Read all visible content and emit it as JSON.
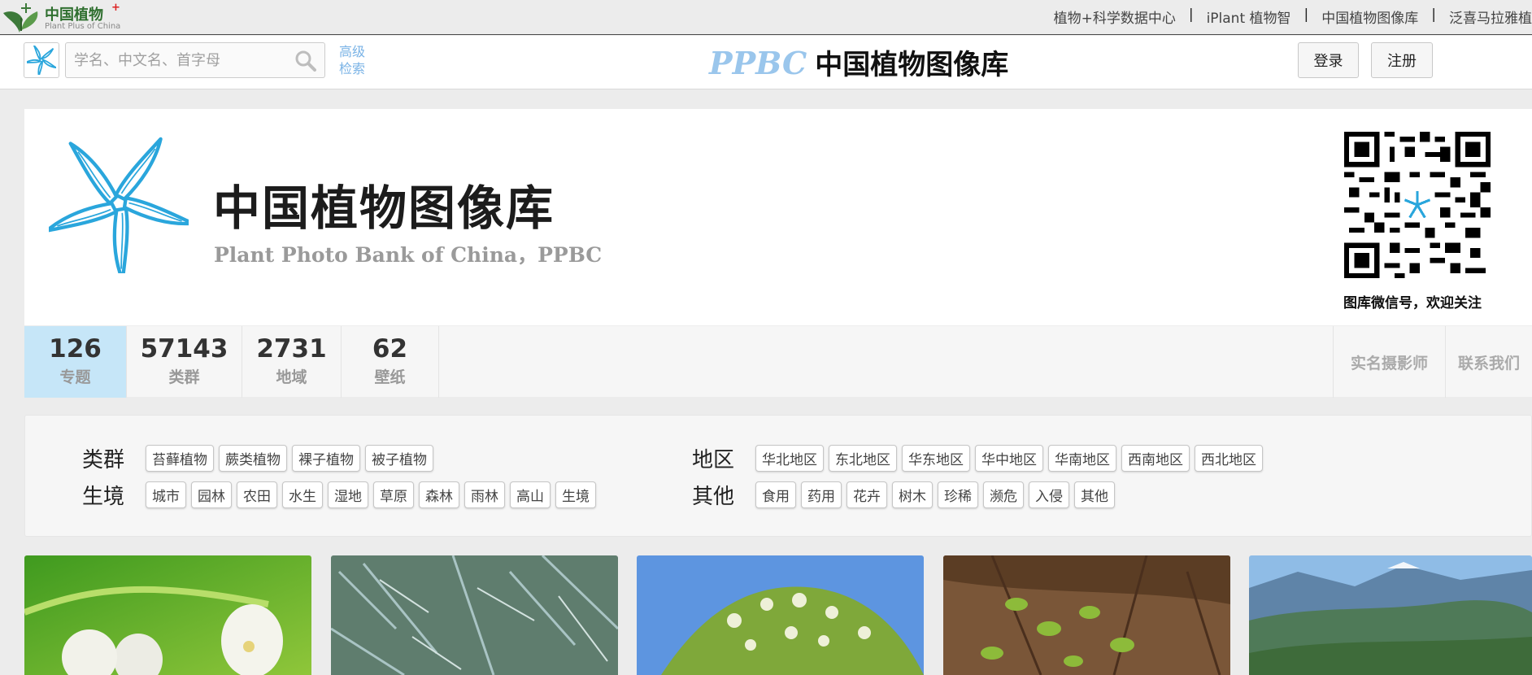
{
  "topbar": {
    "logo_zh": "中国植物",
    "logo_plus": "+",
    "logo_en": "Plant Plus of China",
    "links": [
      "植物+科学数据中心",
      "iPlant 植物智",
      "中国植物图像库",
      "泛喜马拉雅植"
    ]
  },
  "header": {
    "search_placeholder": "学名、中文名、首字母",
    "advanced_line1": "高级",
    "advanced_line2": "检索",
    "brand_en": "PPBC",
    "brand_zh": "中国植物图像库",
    "login_label": "登录",
    "register_label": "注册"
  },
  "banner": {
    "title": "中国植物图像库",
    "subtitle": "Plant Photo Bank of China，PPBC",
    "qr_caption": "图库微信号，欢迎关注"
  },
  "stats": [
    {
      "value": "126",
      "label": "专题"
    },
    {
      "value": "57143",
      "label": "类群"
    },
    {
      "value": "2731",
      "label": "地域"
    },
    {
      "value": "62",
      "label": "壁纸"
    }
  ],
  "right_links": [
    "实名摄影师",
    "联系我们"
  ],
  "tags": {
    "leiqun": {
      "label": "类群",
      "items": [
        "苔藓植物",
        "蕨类植物",
        "裸子植物",
        "被子植物"
      ]
    },
    "shengjing": {
      "label": "生境",
      "items": [
        "城市",
        "园林",
        "农田",
        "水生",
        "湿地",
        "草原",
        "森林",
        "雨林",
        "高山",
        "生境"
      ]
    },
    "diqu": {
      "label": "地区",
      "items": [
        "华北地区",
        "东北地区",
        "华东地区",
        "华中地区",
        "华南地区",
        "西南地区",
        "西北地区"
      ]
    },
    "qita": {
      "label": "其他",
      "items": [
        "食用",
        "药用",
        "花卉",
        "树木",
        "珍稀",
        "濒危",
        "入侵",
        "其他"
      ]
    }
  },
  "colors": {
    "accent_blue": "#9ac6ec",
    "active_stat_bg": "#c6e6f8",
    "logo_green": "#2f6f2f"
  }
}
